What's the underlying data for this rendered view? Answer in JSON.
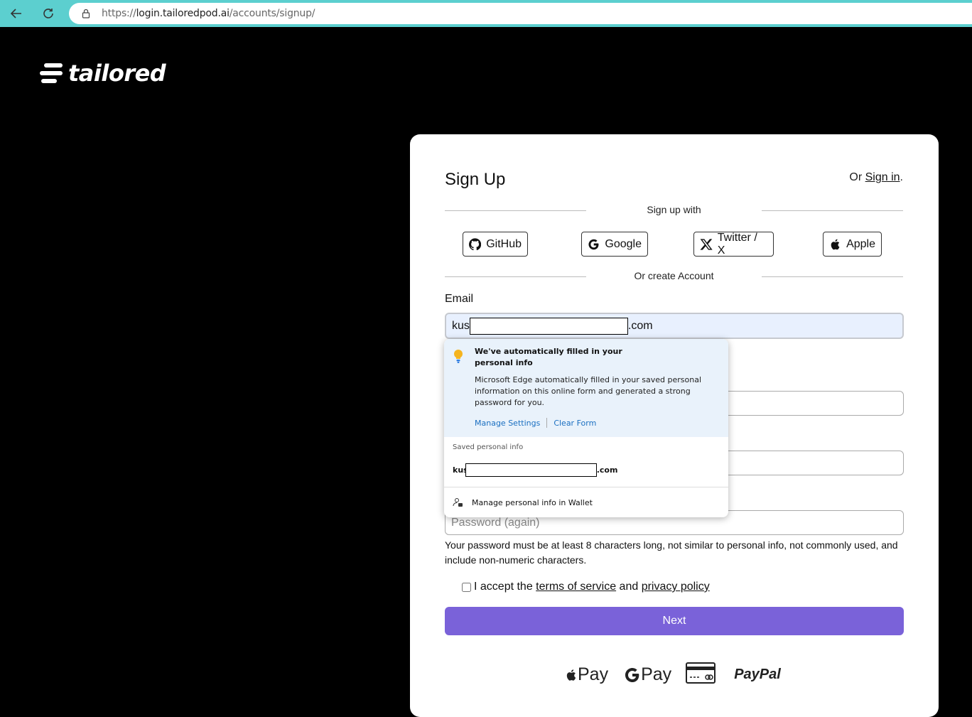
{
  "browser": {
    "url_prefix": "https://",
    "url_host": "login.tailoredpod.ai",
    "url_path": "/accounts/signup/"
  },
  "brand": {
    "name": "tailored"
  },
  "signup": {
    "title": "Sign Up",
    "signin_prefix": "Or ",
    "signin_link": "Sign in",
    "signin_suffix": ".",
    "signup_with": "Sign up with",
    "social": [
      {
        "label": "GitHub",
        "icon": "github-icon"
      },
      {
        "label": "Google",
        "icon": "google-icon"
      },
      {
        "label": "Twitter / X",
        "icon": "x-icon"
      },
      {
        "label": "Apple",
        "icon": "apple-icon"
      }
    ],
    "or_create": "Or create Account",
    "email_label": "Email",
    "email_prefix": "kus",
    "email_suffix": ".com",
    "password_again_placeholder": "Password (again)",
    "password_help": "Your password must be at least 8 characters long, not similar to personal info, not commonly used, and include non-numeric characters.",
    "terms_prefix": "I accept the ",
    "terms_link": "terms of service",
    "terms_and": " and ",
    "privacy_link": "privacy policy",
    "next_label": "Next",
    "payments": {
      "apple": "Pay",
      "google": "Pay",
      "paypal": "PayPal"
    }
  },
  "autofill": {
    "heading": "We've automatically filled in your personal info",
    "description": "Microsoft Edge automatically filled in your saved personal information on this online form and generated a strong password for you.",
    "manage_settings": "Manage Settings",
    "clear_form": "Clear Form",
    "saved_label": "Saved personal info",
    "saved_prefix": "kus",
    "saved_suffix": ".com",
    "wallet": "Manage personal info in Wallet"
  }
}
